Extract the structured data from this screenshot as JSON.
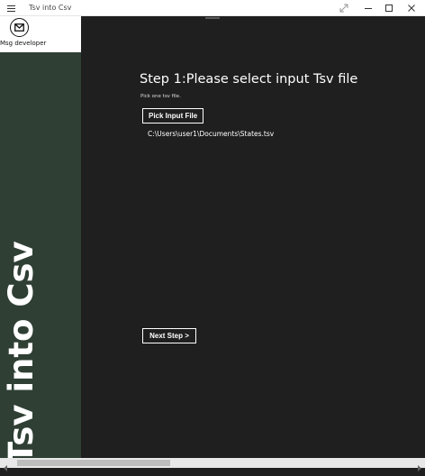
{
  "window": {
    "title": "Tsv into Csv",
    "icons": {
      "menu": "hamburger-menu-icon",
      "expand": "expand-diagonal-icon",
      "minimize": "minimize-icon",
      "maximize": "maximize-icon",
      "close": "close-icon"
    }
  },
  "sidebar": {
    "msg_button": {
      "label": "Msg developer",
      "icon": "mail-icon"
    },
    "brand_text": "Tsv into Csv",
    "bg_color": "#2f3f34"
  },
  "main": {
    "step_title": "Step 1:Please select input Tsv file",
    "hint": "Pick one tsv file.",
    "pick_button_label": "Pick Input File",
    "file_path": "C:\\Users\\user1\\Documents\\States.tsv",
    "next_button_label": "Next Step >",
    "bg_color": "#1f1f1f"
  },
  "scrollbar": {
    "left_icon": "scroll-left-arrow-icon",
    "right_icon": "scroll-right-arrow-icon"
  }
}
